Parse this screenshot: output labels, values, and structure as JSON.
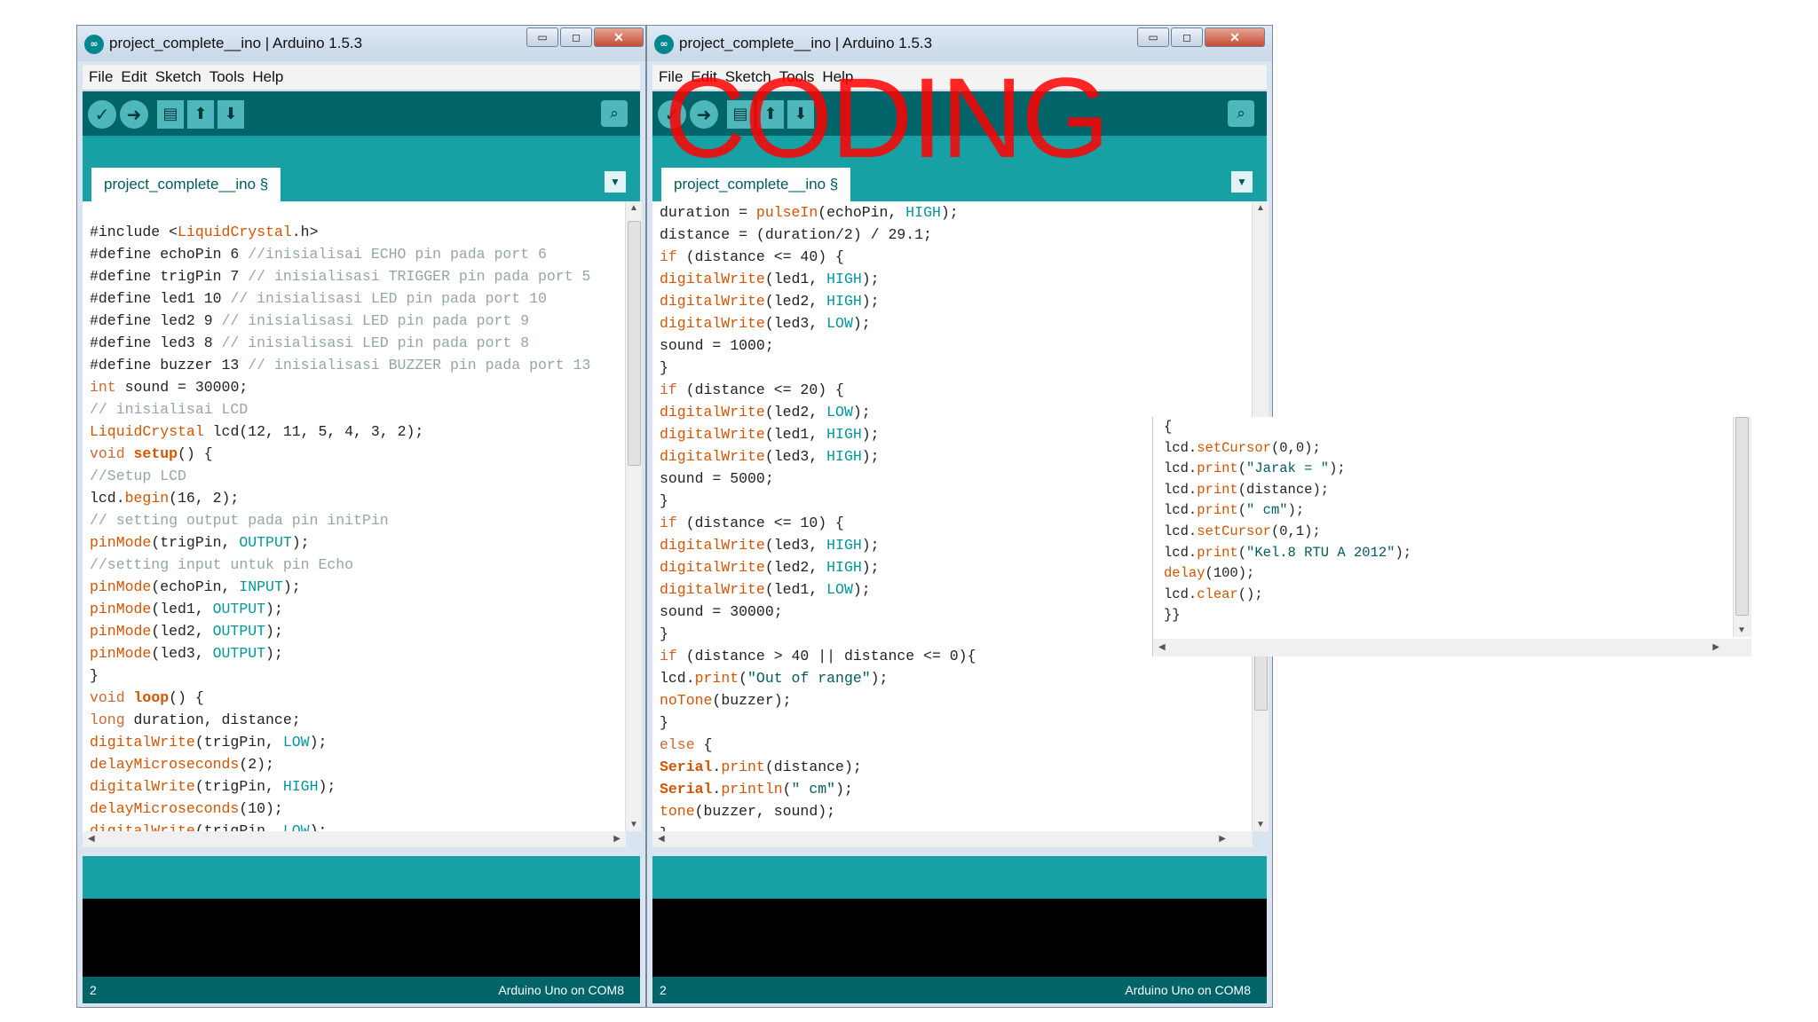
{
  "left_window": {
    "title": "project_complete__ino | Arduino 1.5.3",
    "menu": [
      "File",
      "Edit",
      "Sketch",
      "Tools",
      "Help"
    ],
    "tab_label": "project_complete__ino §",
    "status_line": "2",
    "status_board": "Arduino Uno on COM8",
    "code_lines": [
      [
        {
          "t": "#include <",
          "c": ""
        },
        {
          "t": "LiquidCrystal",
          "c": "c-fn"
        },
        {
          "t": ".h>",
          "c": ""
        }
      ],
      [
        {
          "t": "#define echoPin 6 ",
          "c": ""
        },
        {
          "t": "//inisialisai ECHO pin pada port 6",
          "c": "c-cm"
        }
      ],
      [
        {
          "t": "#define trigPin 7 ",
          "c": ""
        },
        {
          "t": "// inisialisasi TRIGGER pin pada port 5",
          "c": "c-cm"
        }
      ],
      [
        {
          "t": "#define led1 10 ",
          "c": ""
        },
        {
          "t": "// inisialisasi LED pin pada port 10",
          "c": "c-cm"
        }
      ],
      [
        {
          "t": "#define led2 9 ",
          "c": ""
        },
        {
          "t": "// inisialisasi LED pin pada port 9",
          "c": "c-cm"
        }
      ],
      [
        {
          "t": "#define led3 8 ",
          "c": ""
        },
        {
          "t": "// inisialisasi LED pin pada port 8",
          "c": "c-cm"
        }
      ],
      [
        {
          "t": "#define buzzer 13 ",
          "c": ""
        },
        {
          "t": "// inisialisasi BUZZER pin pada port 13",
          "c": "c-cm"
        }
      ],
      [
        {
          "t": "int",
          "c": "c-kw"
        },
        {
          "t": " sound = 30000;",
          "c": ""
        }
      ],
      [
        {
          "t": "// inisialisai LCD",
          "c": "c-cm"
        }
      ],
      [
        {
          "t": "LiquidCrystal",
          "c": "c-fn"
        },
        {
          "t": " lcd(12, 11, 5, 4, 3, 2);",
          "c": ""
        }
      ],
      [
        {
          "t": "void",
          "c": "c-kw"
        },
        {
          "t": " ",
          "c": ""
        },
        {
          "t": "setup",
          "c": "c-bold"
        },
        {
          "t": "() {",
          "c": ""
        }
      ],
      [
        {
          "t": "//Setup LCD",
          "c": "c-cm"
        }
      ],
      [
        {
          "t": "lcd.",
          "c": ""
        },
        {
          "t": "begin",
          "c": "c-fn"
        },
        {
          "t": "(16, 2);",
          "c": ""
        }
      ],
      [
        {
          "t": "// setting output pada pin initPin",
          "c": "c-cm"
        }
      ],
      [
        {
          "t": "pinMode",
          "c": "c-fn"
        },
        {
          "t": "(trigPin, ",
          "c": ""
        },
        {
          "t": "OUTPUT",
          "c": "c-cn"
        },
        {
          "t": ");",
          "c": ""
        }
      ],
      [
        {
          "t": "//setting input untuk pin Echo",
          "c": "c-cm"
        }
      ],
      [
        {
          "t": "pinMode",
          "c": "c-fn"
        },
        {
          "t": "(echoPin, ",
          "c": ""
        },
        {
          "t": "INPUT",
          "c": "c-cn"
        },
        {
          "t": ");",
          "c": ""
        }
      ],
      [
        {
          "t": "pinMode",
          "c": "c-fn"
        },
        {
          "t": "(led1, ",
          "c": ""
        },
        {
          "t": "OUTPUT",
          "c": "c-cn"
        },
        {
          "t": ");",
          "c": ""
        }
      ],
      [
        {
          "t": "pinMode",
          "c": "c-fn"
        },
        {
          "t": "(led2, ",
          "c": ""
        },
        {
          "t": "OUTPUT",
          "c": "c-cn"
        },
        {
          "t": ");",
          "c": ""
        }
      ],
      [
        {
          "t": "pinMode",
          "c": "c-fn"
        },
        {
          "t": "(led3, ",
          "c": ""
        },
        {
          "t": "OUTPUT",
          "c": "c-cn"
        },
        {
          "t": ");",
          "c": ""
        }
      ],
      [
        {
          "t": "}",
          "c": ""
        }
      ],
      [
        {
          "t": "void",
          "c": "c-kw"
        },
        {
          "t": " ",
          "c": ""
        },
        {
          "t": "loop",
          "c": "c-bold"
        },
        {
          "t": "() {",
          "c": ""
        }
      ],
      [
        {
          "t": "long",
          "c": "c-kw"
        },
        {
          "t": " duration, distance;",
          "c": ""
        }
      ],
      [
        {
          "t": "digitalWrite",
          "c": "c-fn"
        },
        {
          "t": "(trigPin, ",
          "c": ""
        },
        {
          "t": "LOW",
          "c": "c-cn"
        },
        {
          "t": ");",
          "c": ""
        }
      ],
      [
        {
          "t": "delayMicroseconds",
          "c": "c-fn"
        },
        {
          "t": "(2);",
          "c": ""
        }
      ],
      [
        {
          "t": "digitalWrite",
          "c": "c-fn"
        },
        {
          "t": "(trigPin, ",
          "c": ""
        },
        {
          "t": "HIGH",
          "c": "c-cn"
        },
        {
          "t": ");",
          "c": ""
        }
      ],
      [
        {
          "t": "delayMicroseconds",
          "c": "c-fn"
        },
        {
          "t": "(10);",
          "c": ""
        }
      ],
      [
        {
          "t": "digitalWrite",
          "c": "c-fn"
        },
        {
          "t": "(trigPin, ",
          "c": ""
        },
        {
          "t": "LOW",
          "c": "c-cn"
        },
        {
          "t": ");",
          "c": ""
        }
      ]
    ]
  },
  "right_window": {
    "title": "project_complete__ino | Arduino 1.5.3",
    "menu": [
      "File",
      "Edit",
      "Sketch",
      "Tools",
      "Help"
    ],
    "tab_label": "project_complete__ino §",
    "status_line": "2",
    "status_board": "Arduino Uno on COM8",
    "code_lines": [
      [
        {
          "t": "duration = ",
          "c": ""
        },
        {
          "t": "pulseIn",
          "c": "c-fn"
        },
        {
          "t": "(echoPin, ",
          "c": ""
        },
        {
          "t": "HIGH",
          "c": "c-cn"
        },
        {
          "t": ");",
          "c": ""
        }
      ],
      [
        {
          "t": "distance = (duration/2) / 29.1;",
          "c": ""
        }
      ],
      [
        {
          "t": "if",
          "c": "c-kw"
        },
        {
          "t": " (distance <= 40) {",
          "c": ""
        }
      ],
      [
        {
          "t": "digitalWrite",
          "c": "c-fn"
        },
        {
          "t": "(led1, ",
          "c": ""
        },
        {
          "t": "HIGH",
          "c": "c-cn"
        },
        {
          "t": ");",
          "c": ""
        }
      ],
      [
        {
          "t": "digitalWrite",
          "c": "c-fn"
        },
        {
          "t": "(led2, ",
          "c": ""
        },
        {
          "t": "HIGH",
          "c": "c-cn"
        },
        {
          "t": ");",
          "c": ""
        }
      ],
      [
        {
          "t": "digitalWrite",
          "c": "c-fn"
        },
        {
          "t": "(led3, ",
          "c": ""
        },
        {
          "t": "LOW",
          "c": "c-cn"
        },
        {
          "t": ");",
          "c": ""
        }
      ],
      [
        {
          "t": "sound = 1000;",
          "c": ""
        }
      ],
      [
        {
          "t": "}",
          "c": ""
        }
      ],
      [
        {
          "t": "if",
          "c": "c-kw"
        },
        {
          "t": " (distance <= 20) {",
          "c": ""
        }
      ],
      [
        {
          "t": "digitalWrite",
          "c": "c-fn"
        },
        {
          "t": "(led2, ",
          "c": ""
        },
        {
          "t": "LOW",
          "c": "c-cn"
        },
        {
          "t": ");",
          "c": ""
        }
      ],
      [
        {
          "t": "digitalWrite",
          "c": "c-fn"
        },
        {
          "t": "(led1, ",
          "c": ""
        },
        {
          "t": "HIGH",
          "c": "c-cn"
        },
        {
          "t": ");",
          "c": ""
        }
      ],
      [
        {
          "t": "digitalWrite",
          "c": "c-fn"
        },
        {
          "t": "(led3, ",
          "c": ""
        },
        {
          "t": "HIGH",
          "c": "c-cn"
        },
        {
          "t": ");",
          "c": ""
        }
      ],
      [
        {
          "t": "sound = 5000;",
          "c": ""
        }
      ],
      [
        {
          "t": "}",
          "c": ""
        }
      ],
      [
        {
          "t": "if",
          "c": "c-kw"
        },
        {
          "t": " (distance <= 10) {",
          "c": ""
        }
      ],
      [
        {
          "t": "digitalWrite",
          "c": "c-fn"
        },
        {
          "t": "(led3, ",
          "c": ""
        },
        {
          "t": "HIGH",
          "c": "c-cn"
        },
        {
          "t": ");",
          "c": ""
        }
      ],
      [
        {
          "t": "digitalWrite",
          "c": "c-fn"
        },
        {
          "t": "(led2, ",
          "c": ""
        },
        {
          "t": "HIGH",
          "c": "c-cn"
        },
        {
          "t": ");",
          "c": ""
        }
      ],
      [
        {
          "t": "digitalWrite",
          "c": "c-fn"
        },
        {
          "t": "(led1, ",
          "c": ""
        },
        {
          "t": "LOW",
          "c": "c-cn"
        },
        {
          "t": ");",
          "c": ""
        }
      ],
      [
        {
          "t": "sound = 30000;",
          "c": ""
        }
      ],
      [
        {
          "t": "}",
          "c": ""
        }
      ],
      [
        {
          "t": "if",
          "c": "c-kw"
        },
        {
          "t": " (distance > 40 || distance <= 0){",
          "c": ""
        }
      ],
      [
        {
          "t": "lcd.",
          "c": ""
        },
        {
          "t": "print",
          "c": "c-fn"
        },
        {
          "t": "(",
          "c": ""
        },
        {
          "t": "\"Out of range\"",
          "c": "c-str"
        },
        {
          "t": ");",
          "c": ""
        }
      ],
      [
        {
          "t": "noTone",
          "c": "c-fn"
        },
        {
          "t": "(buzzer);",
          "c": ""
        }
      ],
      [
        {
          "t": "}",
          "c": ""
        }
      ],
      [
        {
          "t": "else",
          "c": "c-kw"
        },
        {
          "t": " {",
          "c": ""
        }
      ],
      [
        {
          "t": "Serial",
          "c": "c-bold"
        },
        {
          "t": ".",
          "c": ""
        },
        {
          "t": "print",
          "c": "c-fn"
        },
        {
          "t": "(distance);",
          "c": ""
        }
      ],
      [
        {
          "t": "Serial",
          "c": "c-bold"
        },
        {
          "t": ".",
          "c": ""
        },
        {
          "t": "println",
          "c": "c-fn"
        },
        {
          "t": "(",
          "c": ""
        },
        {
          "t": "\" cm\"",
          "c": "c-str"
        },
        {
          "t": ");",
          "c": ""
        }
      ],
      [
        {
          "t": "tone",
          "c": "c-fn"
        },
        {
          "t": "(buzzer, sound);",
          "c": ""
        }
      ],
      [
        {
          "t": "}",
          "c": ""
        }
      ]
    ]
  },
  "popup": {
    "code_lines": [
      [
        {
          "t": "{",
          "c": ""
        }
      ],
      [
        {
          "t": "lcd.",
          "c": ""
        },
        {
          "t": "setCursor",
          "c": "c-fn"
        },
        {
          "t": "(0,0);",
          "c": ""
        }
      ],
      [
        {
          "t": "lcd.",
          "c": ""
        },
        {
          "t": "print",
          "c": "c-fn"
        },
        {
          "t": "(",
          "c": ""
        },
        {
          "t": "\"Jarak = \"",
          "c": "c-str"
        },
        {
          "t": ");",
          "c": ""
        }
      ],
      [
        {
          "t": "lcd.",
          "c": ""
        },
        {
          "t": "print",
          "c": "c-fn"
        },
        {
          "t": "(distance);",
          "c": ""
        }
      ],
      [
        {
          "t": "lcd.",
          "c": ""
        },
        {
          "t": "print",
          "c": "c-fn"
        },
        {
          "t": "(",
          "c": ""
        },
        {
          "t": "\" cm\"",
          "c": "c-str"
        },
        {
          "t": ");",
          "c": ""
        }
      ],
      [
        {
          "t": "lcd.",
          "c": ""
        },
        {
          "t": "setCursor",
          "c": "c-fn"
        },
        {
          "t": "(0,1);",
          "c": ""
        }
      ],
      [
        {
          "t": "lcd.",
          "c": ""
        },
        {
          "t": "print",
          "c": "c-fn"
        },
        {
          "t": "(",
          "c": ""
        },
        {
          "t": "\"Kel.8 RTU A 2012\"",
          "c": "c-str"
        },
        {
          "t": ");",
          "c": ""
        }
      ],
      [
        {
          "t": "delay",
          "c": "c-fn"
        },
        {
          "t": "(100);",
          "c": ""
        }
      ],
      [
        {
          "t": "lcd.",
          "c": ""
        },
        {
          "t": "clear",
          "c": "c-fn"
        },
        {
          "t": "();",
          "c": ""
        }
      ],
      [
        {
          "t": "}}",
          "c": ""
        }
      ]
    ]
  },
  "overlay_text": "CODING",
  "colors": {
    "toolbar": "#006468",
    "tabbar": "#17a1a5",
    "console": "#000000",
    "overlay": "#ff0000"
  }
}
